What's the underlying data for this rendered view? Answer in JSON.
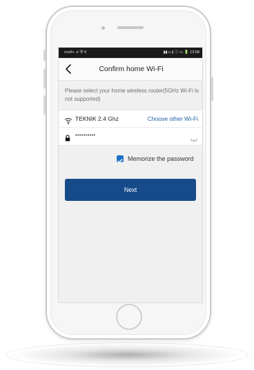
{
  "statusbar": {
    "left": "ırcell+ .ıl 令 K",
    "right": "▮▮ ʊ ∦ ⓘ ▭ 🔋 13:58"
  },
  "header": {
    "title": "Confirm home Wi-Fi"
  },
  "instruction": {
    "text": "Please select your home wireless router(5GHz Wi-Fi is not supported)"
  },
  "wifi": {
    "ssid": "TEKNIK 2.4 Ghz",
    "choose_other": "Choose other Wi-Fi"
  },
  "password": {
    "value": "••••••••••"
  },
  "memorize": {
    "label": "Memorize the password",
    "checked": true
  },
  "actions": {
    "next_label": "Next"
  },
  "icons": {
    "back": "chevron-left-icon",
    "wifi": "wifi-icon",
    "lock": "lock-icon",
    "eye": "eye-closed-icon",
    "check": "check-icon"
  },
  "colors": {
    "primary_button": "#174a8a",
    "link": "#1d5aa6",
    "checkbox": "#1e73c9"
  }
}
